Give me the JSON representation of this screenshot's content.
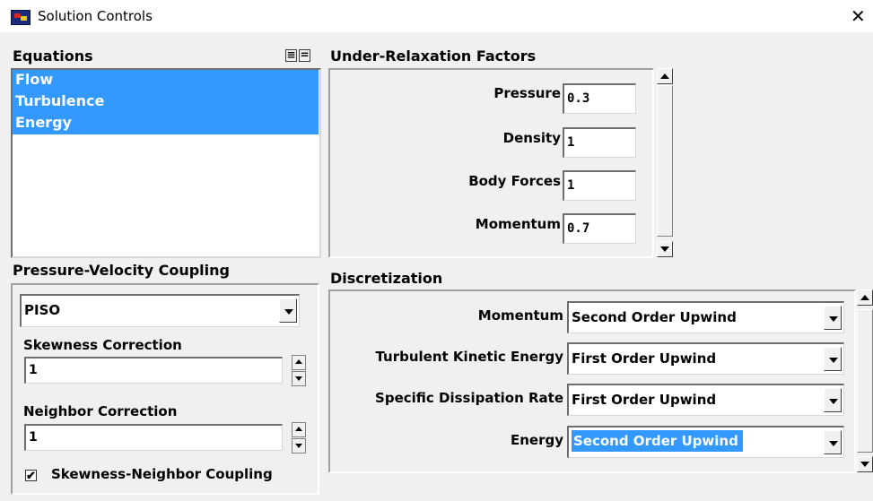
{
  "window": {
    "title": "Solution Controls",
    "close_glyph": "✕"
  },
  "equations": {
    "header": "Equations",
    "items": [
      "Flow",
      "Turbulence",
      "Energy"
    ]
  },
  "under_relaxation": {
    "header": "Under-Relaxation Factors",
    "factors": [
      {
        "label": "Pressure",
        "value": "0.3"
      },
      {
        "label": "Density",
        "value": "1"
      },
      {
        "label": "Body Forces",
        "value": "1"
      },
      {
        "label": "Momentum",
        "value": "0.7"
      }
    ]
  },
  "pv_coupling": {
    "header": "Pressure-Velocity Coupling",
    "scheme": "PISO",
    "skewness_label": "Skewness Correction",
    "skewness_value": "1",
    "neighbor_label": "Neighbor Correction",
    "neighbor_value": "1",
    "coupling_label": "Skewness-Neighbor Coupling",
    "coupling_checked": true
  },
  "discretization": {
    "header": "Discretization",
    "rows": [
      {
        "label": "Momentum",
        "value": "Second Order Upwind"
      },
      {
        "label": "Turbulent Kinetic Energy",
        "value": "First Order Upwind"
      },
      {
        "label": "Specific Dissipation Rate",
        "value": "First Order Upwind"
      },
      {
        "label": "Energy",
        "value": "Second Order Upwind"
      }
    ]
  },
  "icons": {
    "app": "fluent-app-icon",
    "close": "close-icon",
    "dropdown": "chevron-down-icon",
    "checkbox_mark": "✔"
  },
  "colors": {
    "selection": "#3399ff",
    "background": "#f0f0f0"
  }
}
